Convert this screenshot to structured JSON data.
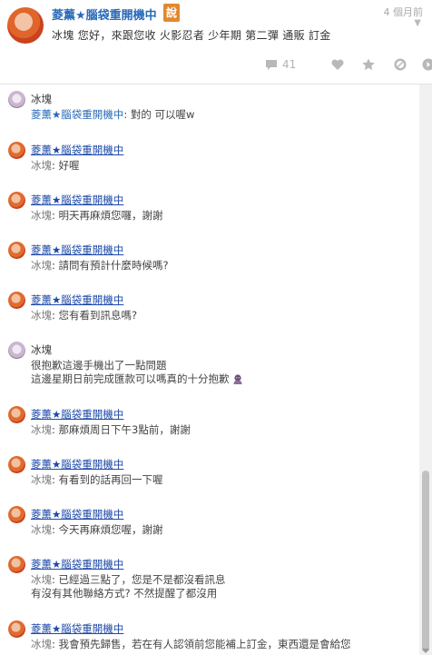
{
  "post": {
    "author": "菱薰★腦袋重開機中",
    "badge": "說",
    "time": "4 個月前",
    "content": "冰塊 您好，來跟您收 火影忍者 少年期 第二彈 通販 訂金",
    "comment_count": "41",
    "icons": [
      "comment-icon",
      "heart-icon",
      "star-icon",
      "block-icon",
      "share-icon",
      "chevron-down-icon"
    ]
  },
  "comments": [
    {
      "name": "冰塊",
      "who": "菱薰★腦袋重開機中",
      "text": ": 對的 可以喔w",
      "line2": ""
    },
    {
      "name": "菱薰★腦袋重開機中",
      "who": "冰塊",
      "text": ": 好喔",
      "line2": ""
    },
    {
      "name": "菱薰★腦袋重開機中",
      "who": "冰塊",
      "text": ": 明天再麻煩您囉，謝謝",
      "line2": ""
    },
    {
      "name": "菱薰★腦袋重開機中",
      "who": "冰塊",
      "text": ": 請問有預計什麼時候嗎?",
      "line2": ""
    },
    {
      "name": "菱薰★腦袋重開機中",
      "who": "冰塊",
      "text": ": 您有看到訊息嗎?",
      "line2": ""
    },
    {
      "name": "冰塊",
      "who": "",
      "text": "很抱歉這邊手機出了一點問題",
      "line2": "這邊星期日前完成匯款可以嗎真的十分抱歉"
    },
    {
      "name": "菱薰★腦袋重開機中",
      "who": "冰塊",
      "text": ": 那麻煩周日下午3點前，謝謝",
      "line2": ""
    },
    {
      "name": "菱薰★腦袋重開機中",
      "who": "冰塊",
      "text": ": 有看到的話再回一下喔",
      "line2": ""
    },
    {
      "name": "菱薰★腦袋重開機中",
      "who": "冰塊",
      "text": ": 今天再麻煩您喔，謝謝",
      "line2": ""
    },
    {
      "name": "菱薰★腦袋重開機中",
      "who": "冰塊",
      "text": ": 已經過三點了，您是不是都沒看訊息",
      "line2": "有沒有其他聯絡方式? 不然提醒了都沒用"
    },
    {
      "name": "菱薰★腦袋重開機中",
      "who": "冰塊",
      "text": ": 我會預先歸售，若在有人認領前您能補上訂金，東西還是會給您",
      "line2": ""
    }
  ]
}
